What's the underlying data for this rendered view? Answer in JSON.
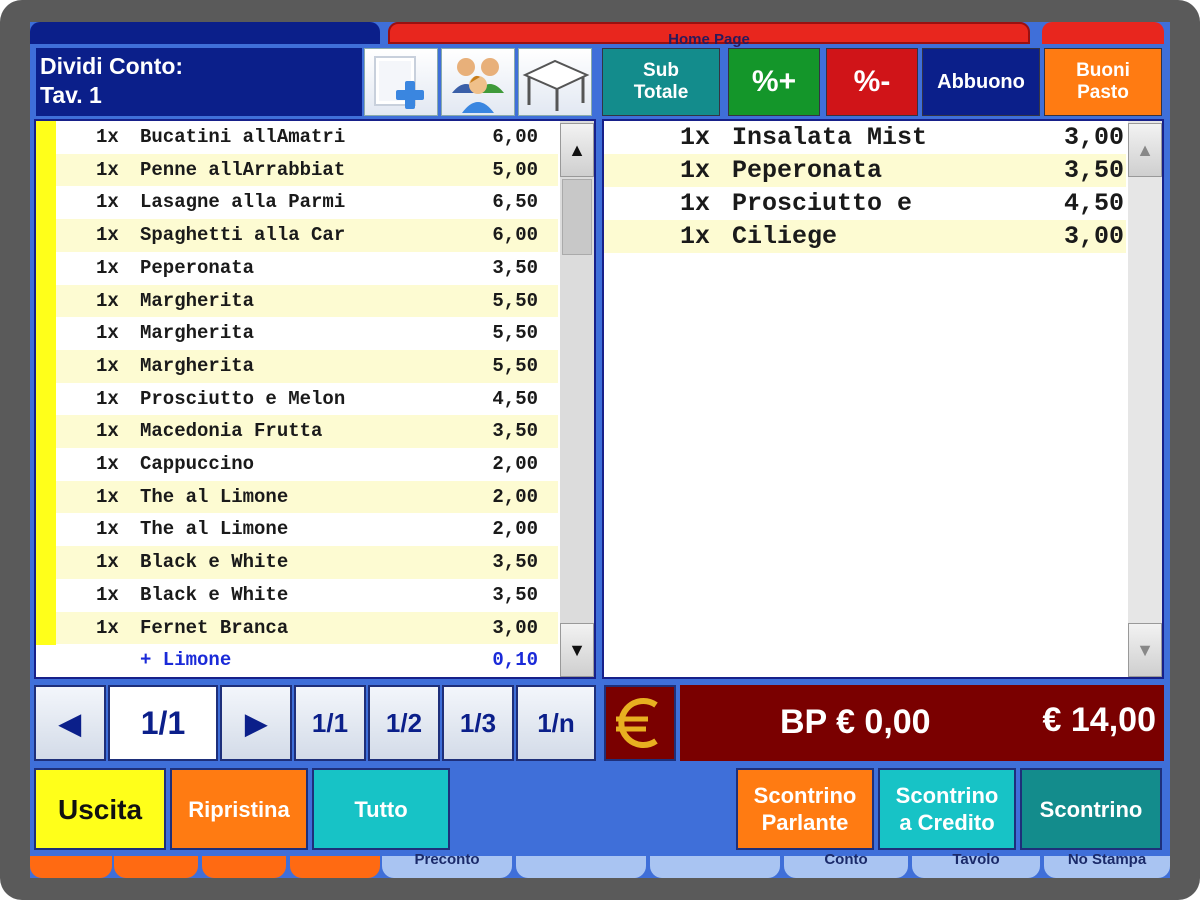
{
  "background": {
    "top_tab": "Home Page",
    "bottom_tabs": [
      "Preconto",
      "Conto",
      "Tavolo",
      "No Stampa"
    ]
  },
  "header": {
    "title_line1": "Dividi Conto:",
    "title_line2": "Tav. 1",
    "icons": [
      "add-item-icon",
      "users-icon",
      "table-icon"
    ]
  },
  "function_buttons": {
    "subtotal_line1": "Sub",
    "subtotal_line2": "Totale",
    "percent_plus": "%+",
    "percent_minus": "%-",
    "abbuono": "Abbuono",
    "buoni_line1": "Buoni",
    "buoni_line2": "Pasto"
  },
  "left_list": {
    "items": [
      {
        "qty": "1x",
        "name": "Bucatini allAmatri",
        "price": "6,00"
      },
      {
        "qty": "1x",
        "name": "Penne allArrabbiat",
        "price": "5,00"
      },
      {
        "qty": "1x",
        "name": "Lasagne alla Parmi",
        "price": "6,50"
      },
      {
        "qty": "1x",
        "name": "Spaghetti alla Car",
        "price": "6,00"
      },
      {
        "qty": "1x",
        "name": "Peperonata",
        "price": "3,50"
      },
      {
        "qty": "1x",
        "name": "Margherita",
        "price": "5,50"
      },
      {
        "qty": "1x",
        "name": "Margherita",
        "price": "5,50"
      },
      {
        "qty": "1x",
        "name": "Margherita",
        "price": "5,50"
      },
      {
        "qty": "1x",
        "name": "Prosciutto e Melon",
        "price": "4,50"
      },
      {
        "qty": "1x",
        "name": "Macedonia Frutta",
        "price": "3,50"
      },
      {
        "qty": "1x",
        "name": "Cappuccino",
        "price": "2,00"
      },
      {
        "qty": "1x",
        "name": "The al Limone",
        "price": "2,00"
      },
      {
        "qty": "1x",
        "name": "The al Limone",
        "price": "2,00"
      },
      {
        "qty": "1x",
        "name": "Black e White",
        "price": "3,50"
      },
      {
        "qty": "1x",
        "name": "Black e White",
        "price": "3,50"
      },
      {
        "qty": "1x",
        "name": "Fernet Branca",
        "price": "3,00"
      }
    ],
    "modifier": {
      "name": "+ Limone",
      "price": "0,10"
    }
  },
  "right_list": {
    "items": [
      {
        "qty": "1x",
        "name": "Insalata Mist",
        "price": "3,00"
      },
      {
        "qty": "1x",
        "name": "Peperonata",
        "price": "3,50"
      },
      {
        "qty": "1x",
        "name": "Prosciutto e",
        "price": "4,50"
      },
      {
        "qty": "1x",
        "name": "Ciliege",
        "price": "3,00"
      }
    ]
  },
  "nav": {
    "page": "1/1",
    "split_1": "1/1",
    "split_2": "1/2",
    "split_3": "1/3",
    "split_n": "1/n"
  },
  "totals": {
    "currency_icon": "euro-icon",
    "bp": "BP € 0,00",
    "total": "€ 14,00"
  },
  "bottom_buttons": {
    "uscita": "Uscita",
    "ripristina": "Ripristina",
    "tutto": "Tutto",
    "scontrino_parlante_1": "Scontrino",
    "scontrino_parlante_2": "Parlante",
    "scontrino_credito_1": "Scontrino",
    "scontrino_credito_2": "a Credito",
    "scontrino": "Scontrino"
  },
  "colors": {
    "frame": "#5a5a5a",
    "background_blue": "#3f6fd9",
    "navy": "#0b1f8a",
    "teal": "#138c8c",
    "green": "#14962a",
    "red": "#d01418",
    "orange": "#ff7b12",
    "cyan": "#17c3c6",
    "yellow": "#ffff1a",
    "maroon": "#7a0000",
    "row_stripe": "#fdfbd2",
    "modifier_blue": "#1a2ad8"
  }
}
